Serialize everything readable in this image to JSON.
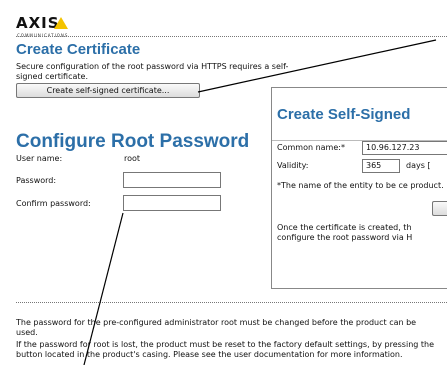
{
  "logo": {
    "brand": "AXIS",
    "tagline": "COMMUNICATIONS"
  },
  "create_certificate": {
    "title": "Create Certificate",
    "description": "Secure configuration of the root password via HTTPS requires a self-signed certificate.",
    "button_label": "Create self-signed certificate..."
  },
  "configure_root": {
    "title": "Configure Root Password",
    "user_name_label": "User name:",
    "user_name_value": "root",
    "password_label": "Password:",
    "password_value": "",
    "confirm_label": "Confirm password:",
    "confirm_value": ""
  },
  "self_signed_panel": {
    "title": "Create Self-Signed",
    "common_name_label": "Common name:*",
    "common_name_value": "10.96.127.23",
    "validity_label": "Validity:",
    "validity_value": "365",
    "validity_unit": "days [",
    "note": "*The name of the entity to be ce product.",
    "footer": "Once the certificate is created, th configure the root password via H"
  },
  "bottom_text": {
    "para1": "The password for the pre-configured administrator root must be changed before the product can be used.",
    "para2": "If the password for root is lost, the product must be reset to the factory default settings, by pressing the button located in the product's casing. Please see the user documentation for more information."
  },
  "colors": {
    "title_blue": "#2c6fa8",
    "logo_yellow": "#f3c300"
  }
}
